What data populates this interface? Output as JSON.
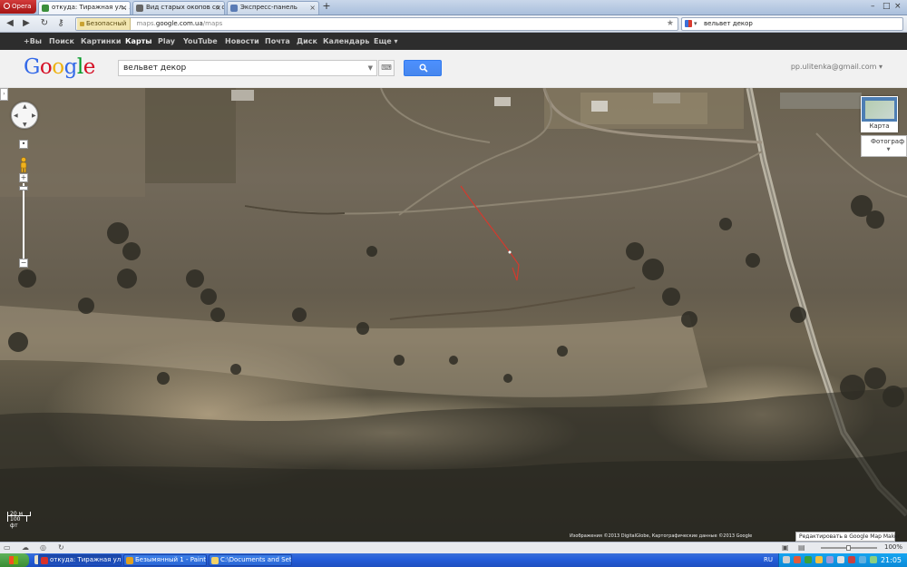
{
  "browser": {
    "menu_label": "Opera",
    "tabs": [
      {
        "title": "откуда: Тиражная ул.; ..."
      },
      {
        "title": "Вид старых окопов со с..."
      },
      {
        "title": "Экспресс-панель"
      }
    ],
    "address": {
      "security_label": "Безопасный",
      "url_prefix": "maps.",
      "url_domain": "google.com.ua",
      "url_path": "/maps"
    },
    "search_box": {
      "value": "вельвет декор"
    }
  },
  "google_bar": {
    "links": [
      "+Вы",
      "Поиск",
      "Картинки",
      "Карты",
      "Play",
      "YouTube",
      "Новости",
      "Почта",
      "Диск",
      "Календарь",
      "Еще ▾"
    ],
    "active": "Карты"
  },
  "google_header": {
    "logo_letters": [
      "G",
      "o",
      "o",
      "g",
      "l",
      "e"
    ],
    "logo_colors": [
      "#3369e8",
      "#d50f25",
      "#eeb211",
      "#3369e8",
      "#009925",
      "#d50f25"
    ],
    "search_value": "вельвет декор",
    "account": "pp.ulitenka@gmail.com ▾"
  },
  "map": {
    "map_type_label": "Карта",
    "photos_label": "Фотограф",
    "scale_metric": "20 м",
    "scale_imperial": "100 фт",
    "credit": "Изображения ©2013 DigitalGlobe, Картографические данные ©2013 Google",
    "mapmaker_link": "Редактировать в Google Map Maker"
  },
  "statusbar": {
    "zoom": "100%"
  },
  "taskbar": {
    "tasks": [
      {
        "title": "откуда: Тиражная ул..."
      },
      {
        "title": "Безымянный 1 - Paint"
      },
      {
        "title": "C:\\Documents and Set..."
      }
    ],
    "language": "RU",
    "clock": "21:05"
  }
}
